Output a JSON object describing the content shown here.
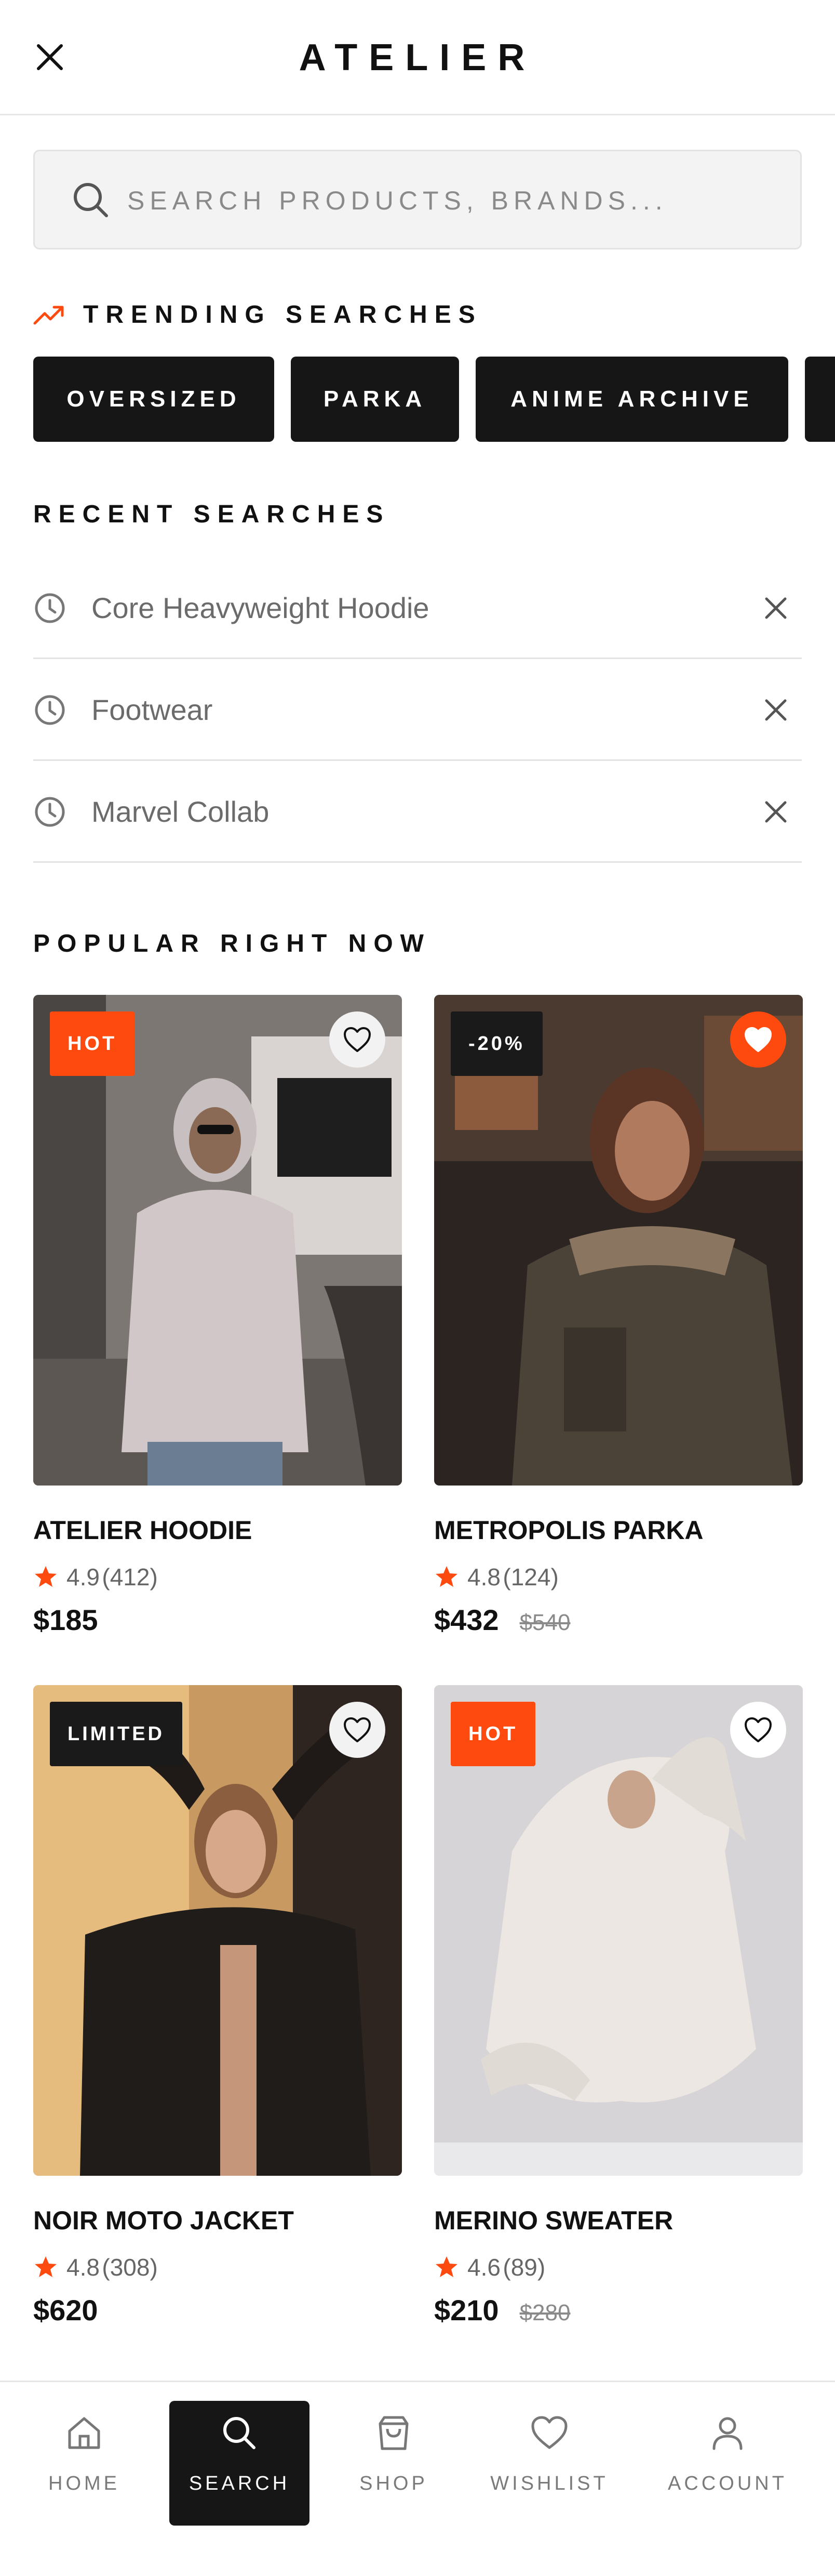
{
  "app": {
    "brand": "ATELIER",
    "accent_color": "#ff4a0f",
    "dark_color": "#161616"
  },
  "header": {
    "close_icon": "close-icon"
  },
  "search": {
    "placeholder": "SEARCH PRODUCTS, BRANDS...",
    "value": "",
    "icon": "search-icon"
  },
  "trending": {
    "title": "TRENDING SEARCHES",
    "icon": "trending-up-icon",
    "chips": [
      "OVERSIZED",
      "PARKA",
      "ANIME ARCHIVE",
      ""
    ]
  },
  "recent": {
    "title": "RECENT SEARCHES",
    "items": [
      {
        "label": "Core Heavyweight Hoodie"
      },
      {
        "label": "Footwear"
      },
      {
        "label": "Marvel Collab"
      }
    ]
  },
  "popular": {
    "title": "POPULAR RIGHT NOW",
    "products": [
      {
        "name": "ATELIER HOODIE",
        "badge": "HOT",
        "badge_style": "orange",
        "rating": "4.9",
        "reviews": "(412)",
        "price": "$185",
        "old_price": "",
        "wishlisted": false
      },
      {
        "name": "METROPOLIS PARKA",
        "badge": "-20%",
        "badge_style": "dark",
        "rating": "4.8",
        "reviews": "(124)",
        "price": "$432",
        "old_price": "$540",
        "wishlisted": true
      },
      {
        "name": "NOIR MOTO JACKET",
        "badge": "LIMITED",
        "badge_style": "dark",
        "rating": "4.8",
        "reviews": "(308)",
        "price": "$620",
        "old_price": "",
        "wishlisted": false
      },
      {
        "name": "MERINO SWEATER",
        "badge": "HOT",
        "badge_style": "orange",
        "rating": "4.6",
        "reviews": "(89)",
        "price": "$210",
        "old_price": "$280",
        "wishlisted": false
      }
    ]
  },
  "nav": {
    "items": [
      {
        "label": "HOME",
        "icon": "home-icon",
        "active": false
      },
      {
        "label": "SEARCH",
        "icon": "search-icon",
        "active": true
      },
      {
        "label": "SHOP",
        "icon": "shopping-bag-icon",
        "active": false
      },
      {
        "label": "WISHLIST",
        "icon": "heart-icon",
        "active": false
      },
      {
        "label": "ACCOUNT",
        "icon": "user-icon",
        "active": false
      }
    ]
  }
}
